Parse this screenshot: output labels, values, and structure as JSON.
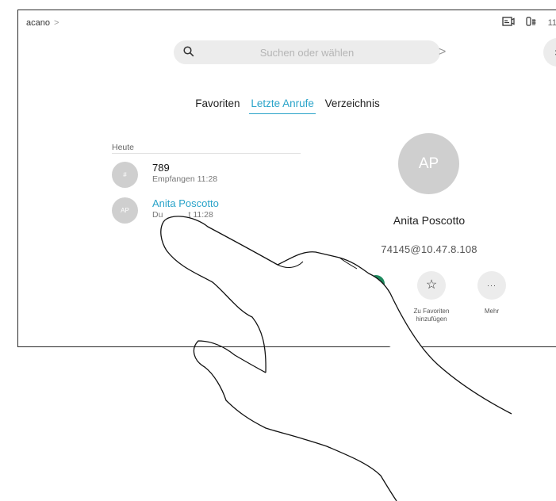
{
  "header": {
    "breadcrumb": "acano",
    "breadcrumb_chevron": ">",
    "status_time": "11"
  },
  "search": {
    "placeholder": "Suchen oder wählen",
    "next_symbol": ">"
  },
  "close_symbol": "×",
  "tabs": [
    {
      "label": "Favoriten",
      "active": false
    },
    {
      "label": "Letzte Anrufe",
      "active": true
    },
    {
      "label": "Verzeichnis",
      "active": false
    }
  ],
  "recents": {
    "section_label": "Heute",
    "items": [
      {
        "avatar": "#",
        "name": "789",
        "detail": "Empfangen 11:28",
        "highlighted": false
      },
      {
        "avatar": "AP",
        "name": "Anita Poscotto",
        "detail": "Du           t 11:28",
        "highlighted": true
      }
    ]
  },
  "contact": {
    "initials": "AP",
    "name": "Anita Poscotto",
    "address": "74145@10.47.8.108"
  },
  "actions": {
    "favorite_icon": "☆",
    "favorite_label_line1": "Zu Favoriten",
    "favorite_label_line2": "hinzufügen",
    "more_icon": "···",
    "more_label": "Mehr"
  },
  "colors": {
    "accent": "#29a3c9",
    "avatar": "#cfcfcf",
    "button_bg": "#ececec",
    "call_button": "#1e8a5e"
  }
}
